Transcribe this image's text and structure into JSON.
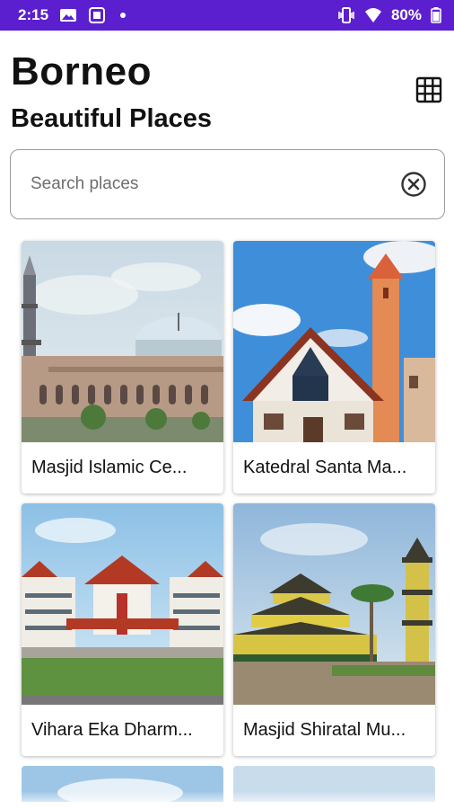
{
  "status_bar": {
    "time": "2:15",
    "battery": "80%",
    "icons": [
      "photo-notification-icon",
      "app-notification-icon",
      "notification-dot-icon",
      "vibrate-icon",
      "wifi-icon",
      "battery-icon"
    ]
  },
  "header": {
    "title": "Borneo",
    "subtitle": "Beautiful Places",
    "grid_icon": "grid-view-icon"
  },
  "search": {
    "placeholder": "Search places",
    "value": "",
    "clear_icon": "clear-circle-icon"
  },
  "places": [
    {
      "name": "Masjid Islamic Ce..."
    },
    {
      "name": "Katedral Santa Ma..."
    },
    {
      "name": "Vihara Eka Dharm..."
    },
    {
      "name": "Masjid Shiratal Mu..."
    }
  ],
  "colors": {
    "status_bar": "#5b1fd0",
    "accent_text": "#111111",
    "search_border": "#9a9a9a"
  }
}
